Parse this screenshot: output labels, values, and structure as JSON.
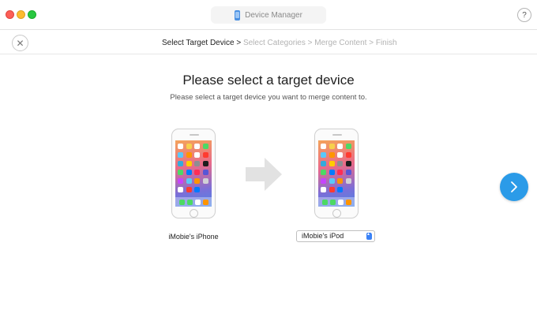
{
  "window": {
    "title": "Device Manager",
    "help_label": "?",
    "close_label": "✕"
  },
  "breadcrumb": {
    "steps": [
      "Select Target Device",
      "Select Categories",
      "Merge Content",
      "Finish"
    ],
    "separator": ">",
    "active_index": 0
  },
  "main": {
    "heading": "Please select a target device",
    "subheading": "Please select a target device you want to merge content to."
  },
  "source_device": {
    "name": "iMobie's iPhone"
  },
  "target_device": {
    "selected": "iMobie's iPod",
    "arrows": "▲▼"
  },
  "colors": {
    "accent": "#2b9be8",
    "breadcrumb_dim": "#b3b3b3",
    "arrow_gray": "#e2e2e2"
  },
  "icons": {
    "device_manager": "phone-icon",
    "next": "chevron-right-icon",
    "transfer": "arrow-right-icon",
    "close": "close-icon",
    "help": "question-mark-icon"
  }
}
